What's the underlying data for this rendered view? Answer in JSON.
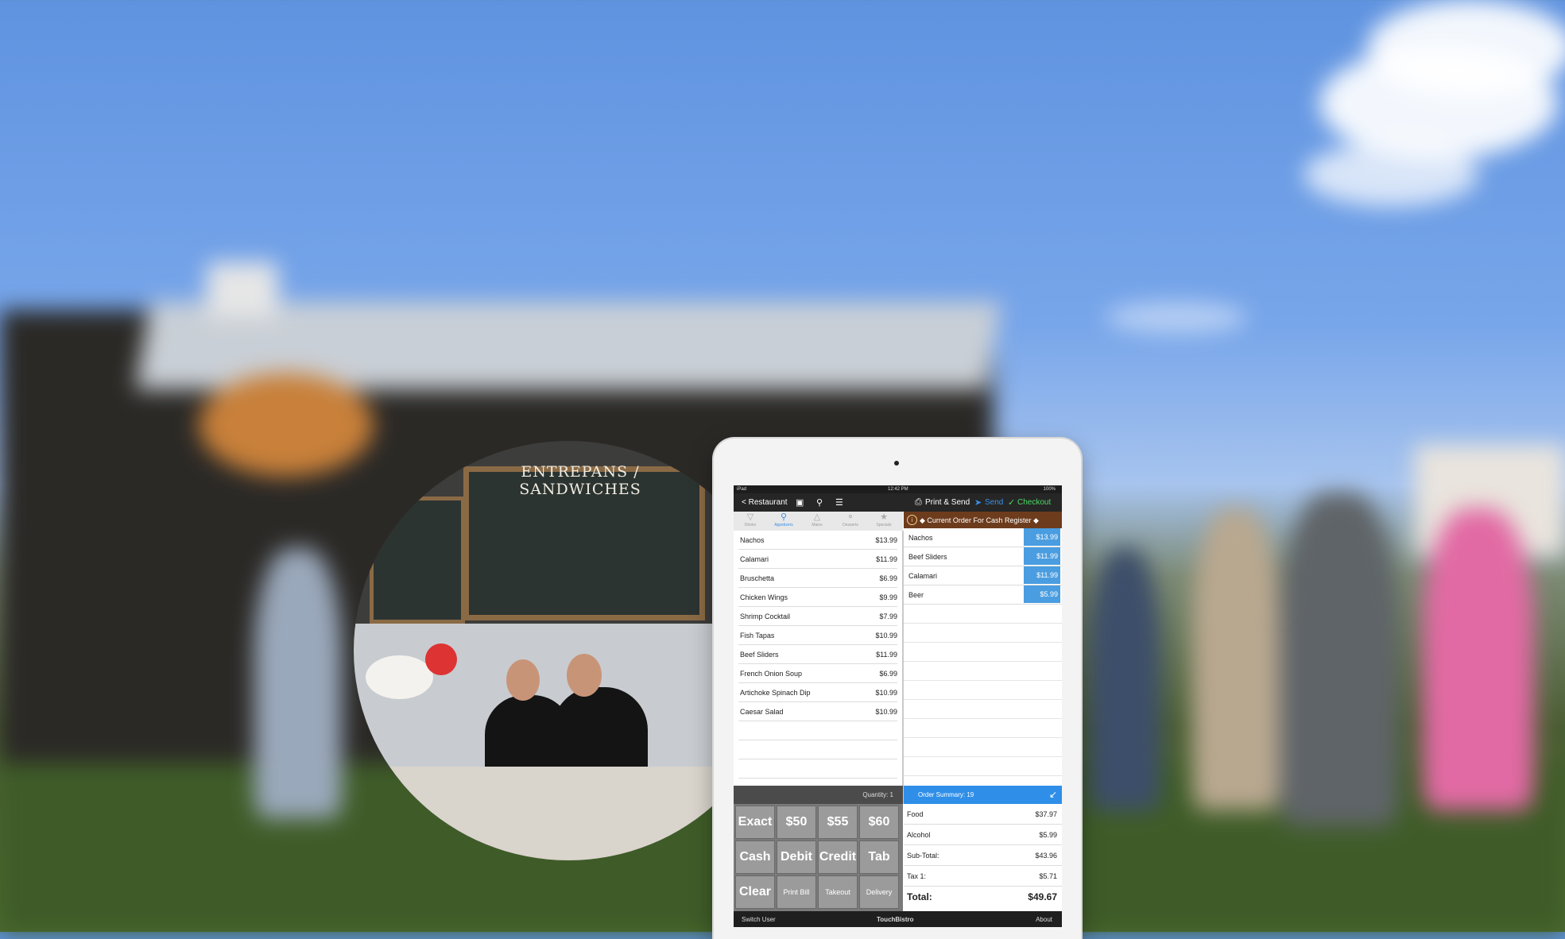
{
  "photo": {
    "board_title": "ENTREPANS / SANDWICHES"
  },
  "status": {
    "device": "iPad",
    "time": "12:42 PM",
    "battery": "100%"
  },
  "nav": {
    "back_label": "< Restaurant",
    "print_send_label": "Print & Send",
    "send_label": "Send",
    "checkout_label": "Checkout",
    "icons": [
      "lock-icon",
      "search-icon",
      "list-icon",
      "printer-icon",
      "send-icon",
      "checkout-icon"
    ]
  },
  "tabs": [
    {
      "label": "Drinks",
      "icon": "glass-icon"
    },
    {
      "label": "Appetizers",
      "icon": "food-icon",
      "active": true
    },
    {
      "label": "Mains",
      "icon": "plate-icon"
    },
    {
      "label": "Desserts",
      "icon": "dessert-icon"
    },
    {
      "label": "Specials",
      "icon": "specials-icon"
    }
  ],
  "menu_items": [
    {
      "name": "Nachos",
      "price": "$13.99"
    },
    {
      "name": "Calamari",
      "price": "$11.99"
    },
    {
      "name": "Bruschetta",
      "price": "$6.99"
    },
    {
      "name": "Chicken Wings",
      "price": "$9.99"
    },
    {
      "name": "Shrimp Cocktail",
      "price": "$7.99"
    },
    {
      "name": "Fish Tapas",
      "price": "$10.99"
    },
    {
      "name": "Beef Sliders",
      "price": "$11.99"
    },
    {
      "name": "French Onion Soup",
      "price": "$6.99"
    },
    {
      "name": "Artichoke Spinach Dip",
      "price": "$10.99"
    },
    {
      "name": "Caesar Salad",
      "price": "$10.99"
    }
  ],
  "order": {
    "header": "◆ Current Order For Cash Register ◆",
    "items": [
      {
        "name": "Nachos",
        "price": "$13.99"
      },
      {
        "name": "Beef Sliders",
        "price": "$11.99"
      },
      {
        "name": "Calamari",
        "price": "$11.99"
      },
      {
        "name": "Beer",
        "price": "$5.99"
      }
    ],
    "summary_label": "Order Summary: 19",
    "quantity_label": "Quantity: 1"
  },
  "keypad": [
    [
      "Exact",
      "$50",
      "$55",
      "$60"
    ],
    [
      "Cash",
      "Debit",
      "Credit",
      "Tab"
    ],
    [
      "Clear",
      "Print Bill",
      "Takeout",
      "Delivery"
    ]
  ],
  "totals": [
    {
      "name": "Food",
      "value": "$37.97"
    },
    {
      "name": "Alcohol",
      "value": "$5.99"
    },
    {
      "name": "Sub-Total:",
      "value": "$43.96"
    },
    {
      "name": "Tax 1:",
      "value": "$5.71"
    },
    {
      "name": "Total:",
      "value": "$49.67"
    }
  ],
  "footer": {
    "left": "Switch User",
    "center": "TouchBistro",
    "right": "About"
  },
  "colors": {
    "order_header": "#6d3c1d",
    "price_highlight": "#4a9de0",
    "summary_bar": "#2f8fe8",
    "checkout_green": "#4cd964",
    "send_blue": "#3a8ee6"
  }
}
